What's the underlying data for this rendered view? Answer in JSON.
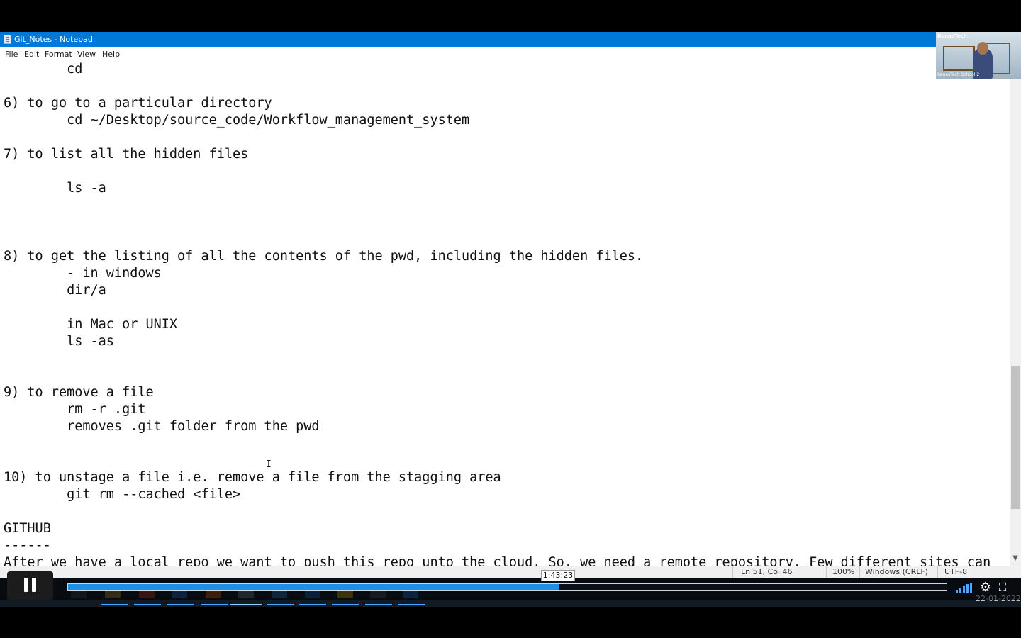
{
  "window": {
    "title": "Git_Notes - Notepad",
    "accent_color": "#0078d7"
  },
  "menu": {
    "file": "File",
    "edit": "Edit",
    "format": "Format",
    "view": "View",
    "help": "Help"
  },
  "editor": {
    "text": "        cd\n\n6) to go to a particular directory\n        cd ~/Desktop/source_code/Workflow_management_system\n\n7) to list all the hidden files\n\n        ls -a\n\n\n\n8) to get the listing of all the contents of the pwd, including the hidden files.\n        - in windows\n        dir/a\n\n        in Mac or UNIX\n        ls -as\n\n\n9) to remove a file\n        rm -r .git\n        removes .git folder from the pwd\n\n\n10) to unstage a file i.e. remove a file from the stagging area\n        git rm --cached <file>\n\nGITHUB\n------\nAfter we have a local repo we want to push this repo unto the cloud. So, we need a remote repository. Few different sites can"
  },
  "statusbar": {
    "position": "Ln 51, Col 46",
    "zoom": "100%",
    "line_ending": "Windows (CRLF)",
    "encoding": "UTF-8"
  },
  "player": {
    "current_time": "1:43:23",
    "progress": 0.559,
    "play_state_icon": "pause-icon",
    "progress_color": "#1d8fe6",
    "volume_icon": "volume-bars-icon",
    "settings_icon": "gear-icon",
    "fullscreen_icon": "fullscreen-icon"
  },
  "taskbar": {
    "date": "22-01-2022"
  },
  "webcam": {
    "brand": "RenasTech",
    "label": "RenasTech School 2"
  }
}
